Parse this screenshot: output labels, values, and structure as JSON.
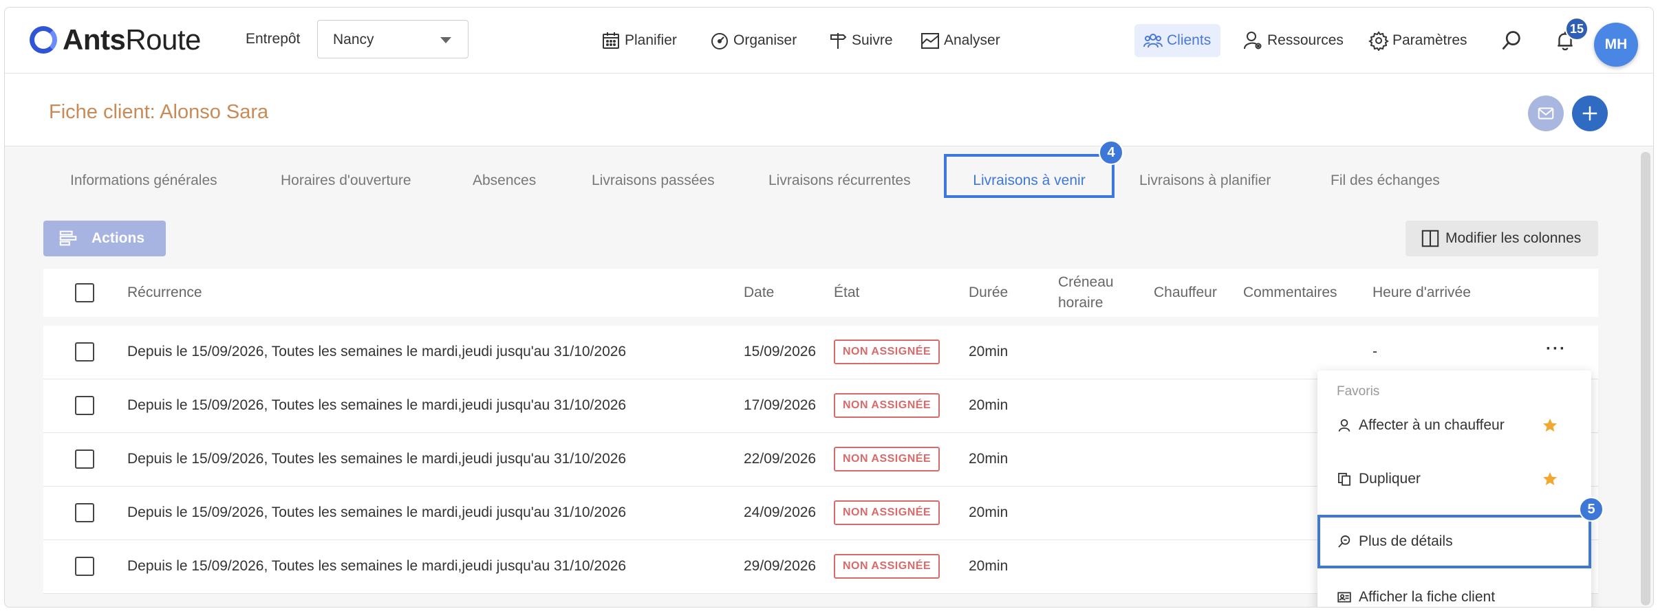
{
  "app": {
    "logo_bold": "Ants",
    "logo_light": "Route"
  },
  "warehouse": {
    "label": "Entrepôt",
    "selected": "Nancy"
  },
  "nav": {
    "planifier": "Planifier",
    "organiser": "Organiser",
    "suivre": "Suivre",
    "analyser": "Analyser",
    "clients": "Clients",
    "ressources": "Ressources",
    "parametres": "Paramètres"
  },
  "notifications": {
    "count": "15"
  },
  "user": {
    "initials": "MH"
  },
  "page": {
    "title": "Fiche client: Alonso Sara"
  },
  "tabs": [
    {
      "label": "Informations générales"
    },
    {
      "label": "Horaires d'ouverture"
    },
    {
      "label": "Absences"
    },
    {
      "label": "Livraisons passées"
    },
    {
      "label": "Livraisons récurrentes"
    },
    {
      "label": "Livraisons à venir",
      "active": true
    },
    {
      "label": "Livraisons à planifier"
    },
    {
      "label": "Fil des échanges"
    }
  ],
  "steps": {
    "tab_step": "4",
    "menu_step": "5"
  },
  "toolbar": {
    "actions_label": "Actions",
    "columns_label": "Modifier les colonnes"
  },
  "table": {
    "headers": {
      "recurrence": "Récurrence",
      "date": "Date",
      "etat": "État",
      "duree": "Durée",
      "creneau_1": "Créneau",
      "creneau_2": "horaire",
      "chauffeur": "Chauffeur",
      "commentaires": "Commentaires",
      "heure_arrivee": "Heure d'arrivée"
    },
    "rows": [
      {
        "recurrence": "Depuis le 15/09/2026, Toutes les semaines le mardi,jeudi jusqu'au 31/10/2026",
        "date": "15/09/2026",
        "status": "NON ASSIGNÉE",
        "duration": "20min",
        "arrival": "-",
        "more": "···"
      },
      {
        "recurrence": "Depuis le 15/09/2026, Toutes les semaines le mardi,jeudi jusqu'au 31/10/2026",
        "date": "17/09/2026",
        "status": "NON ASSIGNÉE",
        "duration": "20min"
      },
      {
        "recurrence": "Depuis le 15/09/2026, Toutes les semaines le mardi,jeudi jusqu'au 31/10/2026",
        "date": "22/09/2026",
        "status": "NON ASSIGNÉE",
        "duration": "20min"
      },
      {
        "recurrence": "Depuis le 15/09/2026, Toutes les semaines le mardi,jeudi jusqu'au 31/10/2026",
        "date": "24/09/2026",
        "status": "NON ASSIGNÉE",
        "duration": "20min"
      },
      {
        "recurrence": "Depuis le 15/09/2026, Toutes les semaines le mardi,jeudi jusqu'au 31/10/2026",
        "date": "29/09/2026",
        "status": "NON ASSIGNÉE",
        "duration": "20min"
      }
    ]
  },
  "menu": {
    "header": "Favoris",
    "items": [
      {
        "label": "Affecter à un chauffeur",
        "icon": "user-icon",
        "favorite": true
      },
      {
        "label": "Dupliquer",
        "icon": "duplicate-icon",
        "favorite": true
      },
      {
        "label": "Plus de détails",
        "icon": "zoom-icon",
        "highlighted": true
      },
      {
        "label": "Afficher la fiche client",
        "icon": "id-card-icon"
      }
    ]
  },
  "colors": {
    "brand": "#2f55d4",
    "accent": "#3d78d8",
    "title": "#c98a55",
    "status_unassigned": "#d86a6a",
    "star": "#f0a830"
  }
}
